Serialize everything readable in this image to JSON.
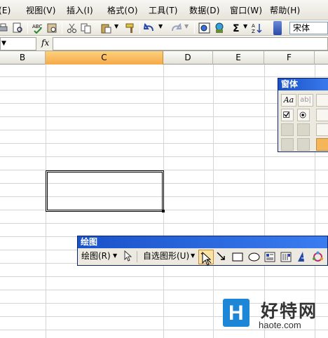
{
  "menu": {
    "items": [
      {
        "label": "(E)"
      },
      {
        "label": "视图(V)"
      },
      {
        "label": "插入(I)"
      },
      {
        "label": "格式(O)"
      },
      {
        "label": "工具(T)"
      },
      {
        "label": "数据(D)"
      },
      {
        "label": "窗口(W)"
      },
      {
        "label": "帮助(H)"
      }
    ]
  },
  "toolbar": {
    "font_name": "宋体",
    "icons": [
      "print-preview-icon",
      "spelling-icon",
      "research-icon",
      "cut-icon",
      "copy-icon",
      "paste-icon",
      "format-painter-icon",
      "undo-icon",
      "redo-icon",
      "hyperlink-icon",
      "chart-wizard-icon",
      "autosum-icon",
      "sort-icon"
    ]
  },
  "formula_bar": {
    "fx_label": "fx",
    "value": ""
  },
  "columns": [
    {
      "label": "B"
    },
    {
      "label": "C",
      "active": true
    },
    {
      "label": "D"
    },
    {
      "label": "E"
    },
    {
      "label": "F"
    }
  ],
  "forms_toolbar": {
    "title": "窗体",
    "label_text": "Aa",
    "edit_text": "ab|"
  },
  "drawing_toolbar": {
    "title": "绘图",
    "draw_menu": "绘图(R)",
    "autoshapes_menu": "自选图形(U)",
    "tools": [
      "select-objects-icon",
      "arrow-icon",
      "rectangle-icon",
      "oval-icon",
      "textbox-icon",
      "vertical-textbox-icon",
      "wordart-icon",
      "diagram-icon"
    ]
  },
  "watermark": {
    "logo_letter": "H",
    "site_name": "好特网",
    "url": "haote.com"
  },
  "colors": {
    "title_bar": "#1a52c8",
    "active_column": "#f5a94a",
    "logo_blue": "#1d86d6"
  }
}
